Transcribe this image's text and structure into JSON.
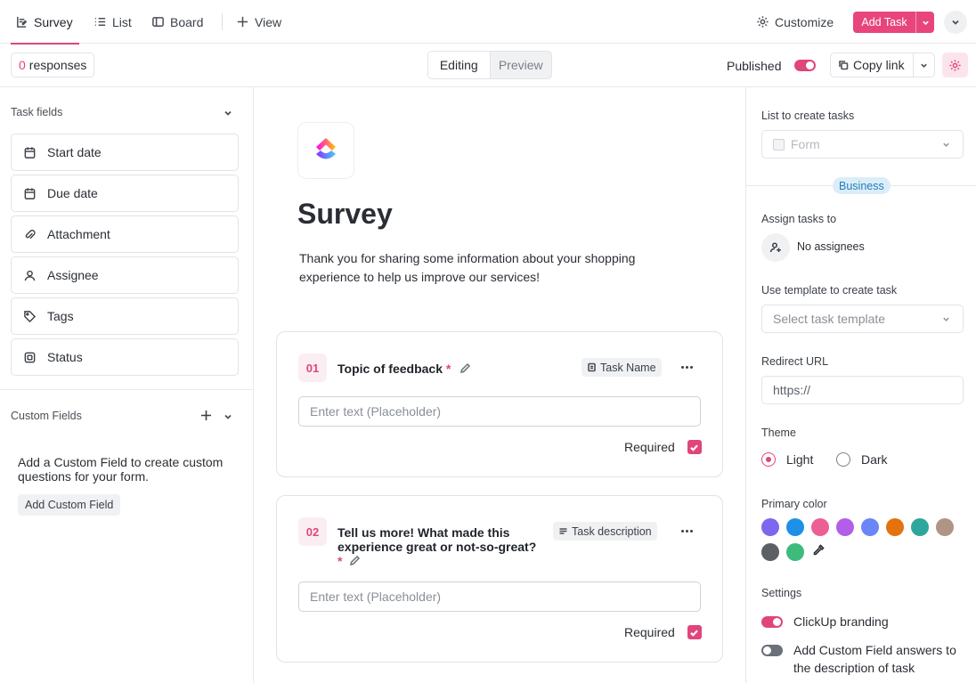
{
  "nav": {
    "tabs": [
      {
        "label": "Survey",
        "icon": "form-icon"
      },
      {
        "label": "List",
        "icon": "list-icon"
      },
      {
        "label": "Board",
        "icon": "board-icon"
      },
      {
        "label": "View",
        "icon": "plus-icon"
      }
    ],
    "customize_label": "Customize",
    "add_task_label": "Add Task"
  },
  "toolbar": {
    "responses_count": "0",
    "responses_label": "responses",
    "mode_editing": "Editing",
    "mode_preview": "Preview",
    "published_label": "Published",
    "published": true,
    "copy_link_label": "Copy link"
  },
  "left_panel": {
    "task_fields_heading": "Task fields",
    "fields": [
      {
        "label": "Start date",
        "icon": "calendar-icon"
      },
      {
        "label": "Due date",
        "icon": "calendar-icon"
      },
      {
        "label": "Attachment",
        "icon": "paperclip-icon"
      },
      {
        "label": "Assignee",
        "icon": "user-icon"
      },
      {
        "label": "Tags",
        "icon": "tag-icon"
      },
      {
        "label": "Status",
        "icon": "status-icon"
      }
    ],
    "custom_fields_heading": "Custom Fields",
    "custom_fields_description": "Add a Custom Field to create custom questions for your form.",
    "add_custom_field_label": "Add Custom Field"
  },
  "form": {
    "title": "Survey",
    "description": "Thank you for sharing some information about your shopping experience to help us improve our services!",
    "questions": [
      {
        "number": "01",
        "text": "Topic of feedback",
        "tag": "Task Name",
        "placeholder": "Enter text (Placeholder)",
        "required_label": "Required",
        "required": true
      },
      {
        "number": "02",
        "text": "Tell us more! What made this experience great or not-so-great?",
        "tag": "Task description",
        "placeholder": "Enter text (Placeholder)",
        "required_label": "Required",
        "required": true
      }
    ],
    "required_marker": "*"
  },
  "right_panel": {
    "list_label": "List to create tasks",
    "list_value": "Form",
    "business_badge": "Business",
    "assign_label": "Assign tasks to",
    "no_assignees": "No assignees",
    "template_label": "Use template to create task",
    "template_placeholder": "Select task template",
    "redirect_label": "Redirect URL",
    "redirect_placeholder": "https://",
    "theme_label": "Theme",
    "theme_light": "Light",
    "theme_dark": "Dark",
    "theme_selected": "Light",
    "primary_color_label": "Primary color",
    "colors": [
      "#7b68ee",
      "#1e90e8",
      "#ec5f95",
      "#b35ee8",
      "#6a86f7",
      "#e3720f",
      "#2fa69b",
      "#b09484",
      "#5c5f66",
      "#3dbb7d"
    ],
    "settings_label": "Settings",
    "branding_label": "ClickUp branding",
    "branding_on": true,
    "custom_answers_label": "Add Custom Field answers to the description of task",
    "custom_answers_on": false
  },
  "theme": {
    "accent": "#e0457b"
  }
}
